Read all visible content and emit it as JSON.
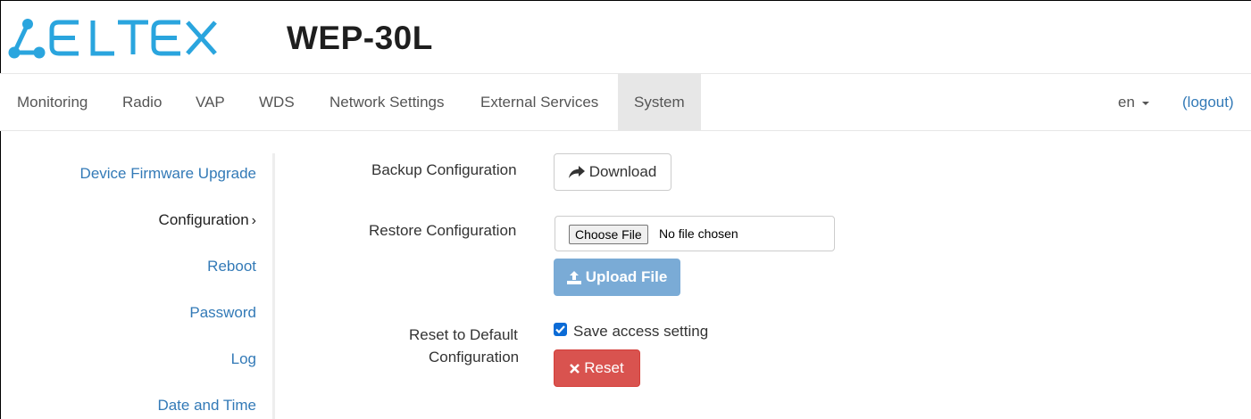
{
  "header": {
    "brand": "ELTEX",
    "model": "WEP-30L"
  },
  "nav": {
    "items": [
      "Monitoring",
      "Radio",
      "VAP",
      "WDS",
      "Network Settings",
      "External Services",
      "System"
    ],
    "active": "System",
    "lang": "en",
    "logout": "(logout)"
  },
  "sidebar": {
    "items": [
      "Device Firmware Upgrade",
      "Configuration",
      "Reboot",
      "Password",
      "Log",
      "Date and Time"
    ],
    "active_chevron": "›"
  },
  "form": {
    "backup_label": "Backup Configuration",
    "download_label": "Download",
    "restore_label": "Restore Configuration",
    "choose_file_label": "Choose File",
    "no_file_text": "No file chosen",
    "upload_label": "Upload File",
    "reset_label_line1": "Reset to Default",
    "reset_label_line2": "Configuration",
    "save_access_label": "Save access setting",
    "save_access_checked": true,
    "reset_button_label": "Reset"
  },
  "colors": {
    "brand_blue": "#2aa5de",
    "link": "#337ab7",
    "upload": "#7aabd6",
    "danger": "#d9534f"
  }
}
